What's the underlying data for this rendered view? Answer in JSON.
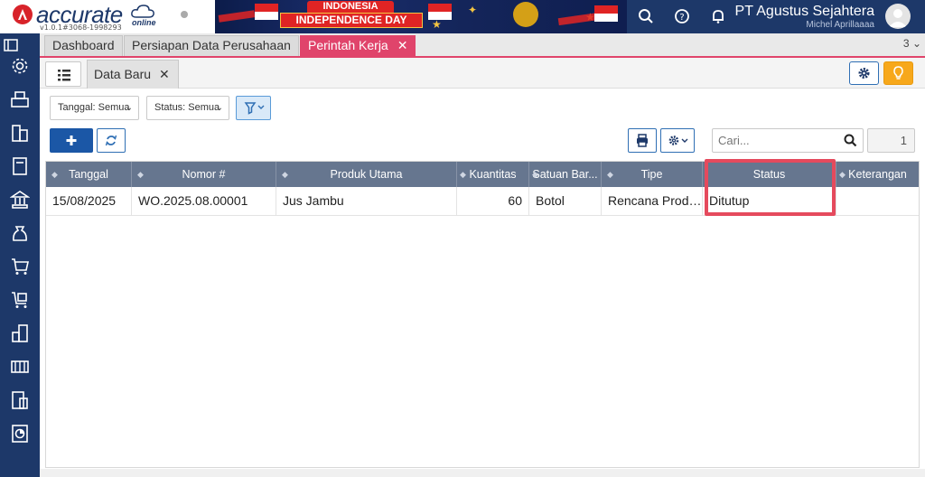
{
  "app": {
    "logo_text": "accurate",
    "logo_sub": "online",
    "version": "v1.0.1#3068-1998293"
  },
  "banner": {
    "line1": "INDONESIA",
    "line2": "INDEPENDENCE DAY"
  },
  "header": {
    "company": "PT Agustus Sejahtera",
    "user": "Michel Aprillaaaa"
  },
  "sidebar": {
    "icons": [
      "settings-icon",
      "cashier-icon",
      "company-icon",
      "ledger-icon",
      "bank-icon",
      "cash-bag-icon",
      "sales-cart-icon",
      "purchase-cart-icon",
      "inventory-icon",
      "manufacturing-icon",
      "tax-icon",
      "report-icon"
    ]
  },
  "tabs": [
    {
      "label": "Dashboard"
    },
    {
      "label": "Persiapan Data Perusahaan"
    },
    {
      "label": "Perintah Kerja",
      "active": true,
      "close": "✕"
    }
  ],
  "tab_count": "3",
  "subtab": {
    "label": "Data Baru",
    "close": "✕"
  },
  "filters": {
    "tanggal": "Tanggal: Semua",
    "status": "Status: Semua"
  },
  "search": {
    "placeholder": "Cari...",
    "value": ""
  },
  "pagination": {
    "page": "1"
  },
  "table": {
    "columns": [
      "Tanggal",
      "Nomor #",
      "Produk Utama",
      "Kuantitas",
      "Satuan Bar...",
      "Tipe",
      "Status",
      "Keterangan"
    ],
    "rows": [
      {
        "tanggal": "15/08/2025",
        "nomor": "WO.2025.08.00001",
        "produk": "Jus Jambu",
        "kuantitas": "60",
        "satuan": "Botol",
        "tipe": "Rencana Produ...",
        "status": "Ditutup",
        "keterangan": ""
      }
    ]
  },
  "colors": {
    "brand_navy": "#1d3869",
    "tab_active": "#e0446b",
    "header_grid": "#66768f",
    "primary_button": "#1b57a6",
    "highlight_box": "#e54a5d",
    "accent_orange": "#f7a81b"
  }
}
